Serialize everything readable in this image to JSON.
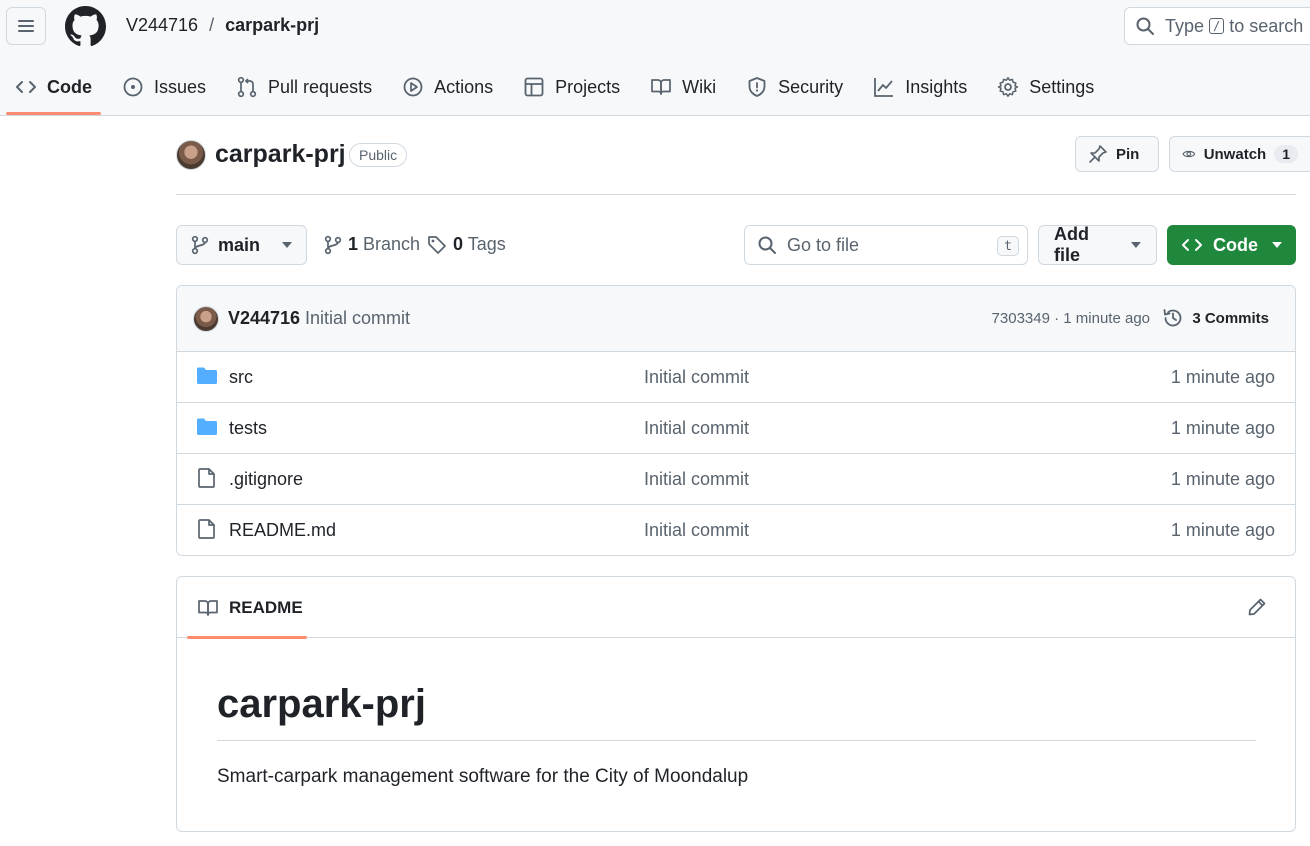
{
  "header": {
    "owner": "V244716",
    "separator": "/",
    "repo": "carpark-prj",
    "search": {
      "before": "Type",
      "key": "/",
      "after": "to search"
    }
  },
  "tabs": [
    {
      "label": "Code",
      "icon": "code-icon",
      "active": true
    },
    {
      "label": "Issues",
      "icon": "issue-icon"
    },
    {
      "label": "Pull requests",
      "icon": "pull-request-icon"
    },
    {
      "label": "Actions",
      "icon": "play-icon"
    },
    {
      "label": "Projects",
      "icon": "table-icon"
    },
    {
      "label": "Wiki",
      "icon": "book-icon"
    },
    {
      "label": "Security",
      "icon": "shield-icon"
    },
    {
      "label": "Insights",
      "icon": "graph-icon"
    },
    {
      "label": "Settings",
      "icon": "gear-icon"
    }
  ],
  "repo_header": {
    "name": "carpark-prj",
    "visibility": "Public",
    "pin_label": "Pin",
    "unwatch_label": "Unwatch",
    "watch_count": "1"
  },
  "branch_bar": {
    "branch": "main",
    "branch_count": "1",
    "branch_label": "Branch",
    "tag_count": "0",
    "tag_label": "Tags",
    "goto_placeholder": "Go to file",
    "goto_key": "t",
    "add_file": "Add file",
    "code": "Code"
  },
  "latest_commit": {
    "author": "V244716",
    "message": "Initial commit",
    "meta": "7303349 · 1 minute ago",
    "commits": "3 Commits"
  },
  "files": [
    {
      "name": "src",
      "type": "folder",
      "commit": "Initial commit",
      "time": "1 minute ago"
    },
    {
      "name": "tests",
      "type": "folder",
      "commit": "Initial commit",
      "time": "1 minute ago"
    },
    {
      "name": ".gitignore",
      "type": "file",
      "commit": "Initial commit",
      "time": "1 minute ago"
    },
    {
      "name": "README.md",
      "type": "file",
      "commit": "Initial commit",
      "time": "1 minute ago"
    }
  ],
  "readme": {
    "tab": "README",
    "title": "carpark-prj",
    "body": "Smart-carpark management software for the City of Moondalup"
  },
  "colors": {
    "accent_underline": "#fd8c73",
    "code_button": "#1f883d",
    "folder": "#54aeff"
  }
}
